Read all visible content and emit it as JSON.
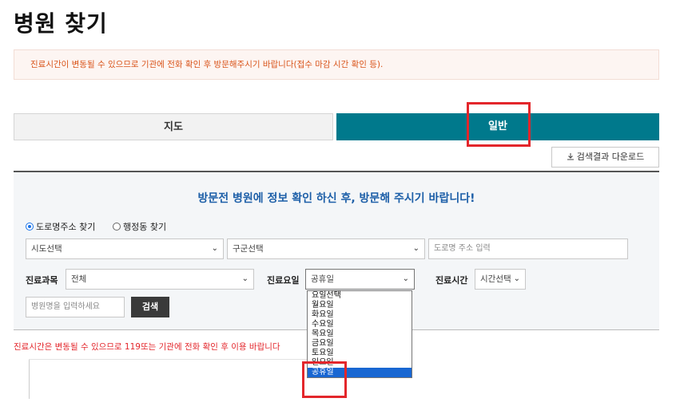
{
  "page": {
    "title": "병원 찾기"
  },
  "notice": {
    "text": "진료시간이 변동될 수 있으므로 기관에 전화 확인 후 방문해주시기 바랍니다(접수 마감 시간 확인 등)."
  },
  "tabs": [
    {
      "label": "지도",
      "active": false
    },
    {
      "label": "일반",
      "active": true
    }
  ],
  "download": {
    "label": "검색결과 다운로드",
    "icon": "download-icon"
  },
  "search": {
    "heading": "방문전 병원에 정보 확인 하신 후, 방문해 주시기 바랍니다!",
    "radios": [
      {
        "label": "도로명주소 찾기",
        "checked": true
      },
      {
        "label": "행정동 찾기",
        "checked": false
      }
    ],
    "sido_select": "시도선택",
    "gugun_select": "구군선택",
    "road_placeholder": "도로명 주소 입력",
    "dept_label": "진료과목",
    "dept_value": "전체",
    "day_label": "진료요일",
    "day_value": "공휴일",
    "time_label": "진료시간",
    "time_value": "시간선택",
    "name_placeholder": "병원명을 입력하세요",
    "search_button": "검색"
  },
  "day_options": [
    "요일선택",
    "월요일",
    "화요일",
    "수요일",
    "목요일",
    "금요일",
    "토요일",
    "일요일",
    "공휴일"
  ],
  "day_selected_index": 8,
  "warning": {
    "text": "진료시간은 변동될 수 있으므로 119또는 기관에 전화 확인 후 이용 바랍니다"
  },
  "colors": {
    "accent": "#00798c",
    "highlight": "#e3262b",
    "heading": "#1d5fa8",
    "notice_text": "#d9541a",
    "selected_option": "#1967d2"
  }
}
